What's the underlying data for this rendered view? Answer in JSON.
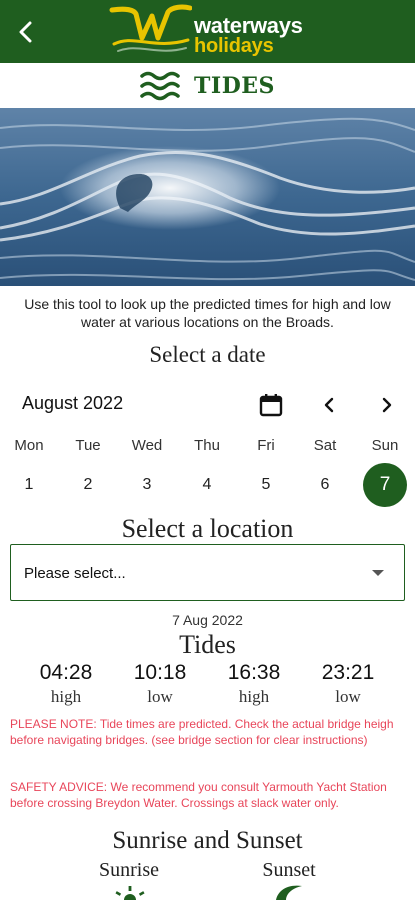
{
  "header": {
    "back_icon": "chevron-left-icon",
    "logo_line1": "waterways",
    "logo_line2": "holidays"
  },
  "page": {
    "title": "TIDES",
    "title_icon": "waves-icon"
  },
  "intro": "Use this tool to look up the predicted times for high and low water at various locations on the Broads.",
  "date_picker": {
    "heading": "Select a date",
    "month_label": "August 2022",
    "weekdays": [
      "Mon",
      "Tue",
      "Wed",
      "Thu",
      "Fri",
      "Sat",
      "Sun"
    ],
    "dates": [
      "1",
      "2",
      "3",
      "4",
      "5",
      "6",
      "7"
    ],
    "selected_index": 6
  },
  "location": {
    "heading": "Select a location",
    "placeholder": "Please select..."
  },
  "tides": {
    "selected_date": "7 Aug 2022",
    "heading": "Tides",
    "entries": [
      {
        "time": "04:28",
        "type": "high"
      },
      {
        "time": "10:18",
        "type": "low"
      },
      {
        "time": "16:38",
        "type": "high"
      },
      {
        "time": "23:21",
        "type": "low"
      }
    ]
  },
  "notes": {
    "please_note": "PLEASE NOTE: Tide times are predicted. Check the actual bridge heigh before navigating bridges. (see bridge section for clear instructions)",
    "safety": "SAFETY ADVICE: We recommend you consult Yarmouth Yacht Station before crossing Breydon Water. Crossings at slack water only."
  },
  "sun": {
    "heading": "Sunrise and Sunset",
    "sunrise_label": "Sunrise",
    "sunset_label": "Sunset"
  },
  "colors": {
    "brand_green": "#1f5e1f",
    "brand_yellow": "#e8c400",
    "warning_red": "#e8465a"
  }
}
